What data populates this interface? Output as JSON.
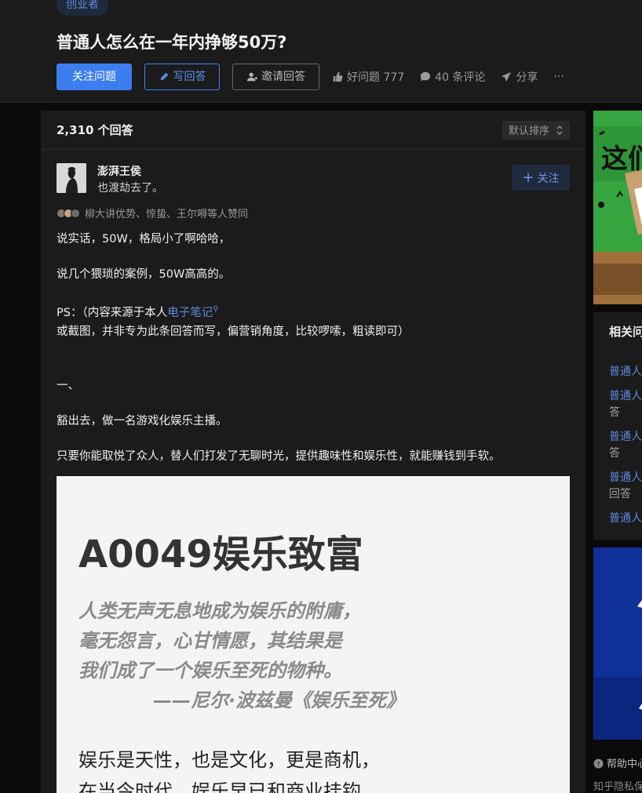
{
  "question": {
    "tag": "创业者",
    "title": "普通人怎么在一年内挣够50万?",
    "actions": {
      "follow_question": "关注问题",
      "write_answer": "写回答",
      "invite_answer": "邀请回答",
      "good_question": "好问题 777",
      "comments": "40 条评论",
      "share": "分享",
      "more": "···"
    }
  },
  "answers": {
    "count_label": "2,310 个回答",
    "sort_label": "默认排序"
  },
  "answer": {
    "author_name": "澎湃王侯",
    "author_bio": "也渡劫去了。",
    "follow_label": "关注",
    "voters_text": "柳大讲优势、惊蛰、王尔嘚等人赞同",
    "paragraphs": {
      "p1": "说实话，50W，格局小了啊哈哈，",
      "p2": "说几个猥琐的案例，50W高高的。",
      "p3_pre": "PS：（内容来源于本人",
      "p3_link": "电子笔记",
      "p3_post": "或截图，并非专为此条回答而写，偏营销角度，比较啰嗦，粗读即可）",
      "p4": "一、",
      "p5": "豁出去，做一名游戏化娱乐主播。",
      "p6": "只要你能取悦了众人，替人们打发了无聊时光，提供趣味性和娱乐性，就能赚钱到手软。"
    },
    "image": {
      "title": "A0049娱乐致富",
      "quote_l1": "人类无声无息地成为娱乐的附庸，",
      "quote_l2": "毫无怨言，心甘情愿，其结果是",
      "quote_l3": "我们成了一个娱乐至死的物种。",
      "quote_src": "——尼尔·波兹曼《娱乐至死》",
      "body_l1": "娱乐是天性，也是文化，更是商机，",
      "body_l2": "在当今时代，娱乐早已和商业挂钩，"
    }
  },
  "sidebar": {
    "ad_text": "这们",
    "related_title": "相关问",
    "related": [
      {
        "label": "普通人",
        "sub": ""
      },
      {
        "label": "普通人",
        "sub": "答"
      },
      {
        "label": "普通人",
        "sub": "答"
      },
      {
        "label": "普通人",
        "sub": "回答"
      },
      {
        "label": "普通人",
        "sub": ""
      }
    ],
    "help": "帮助中心",
    "privacy": "知乎隐私保"
  },
  "colors": {
    "accent": "#3c7ef0",
    "link": "#5b8bd6",
    "bg": "#0a0a0a",
    "panel": "#1b1b1c"
  }
}
